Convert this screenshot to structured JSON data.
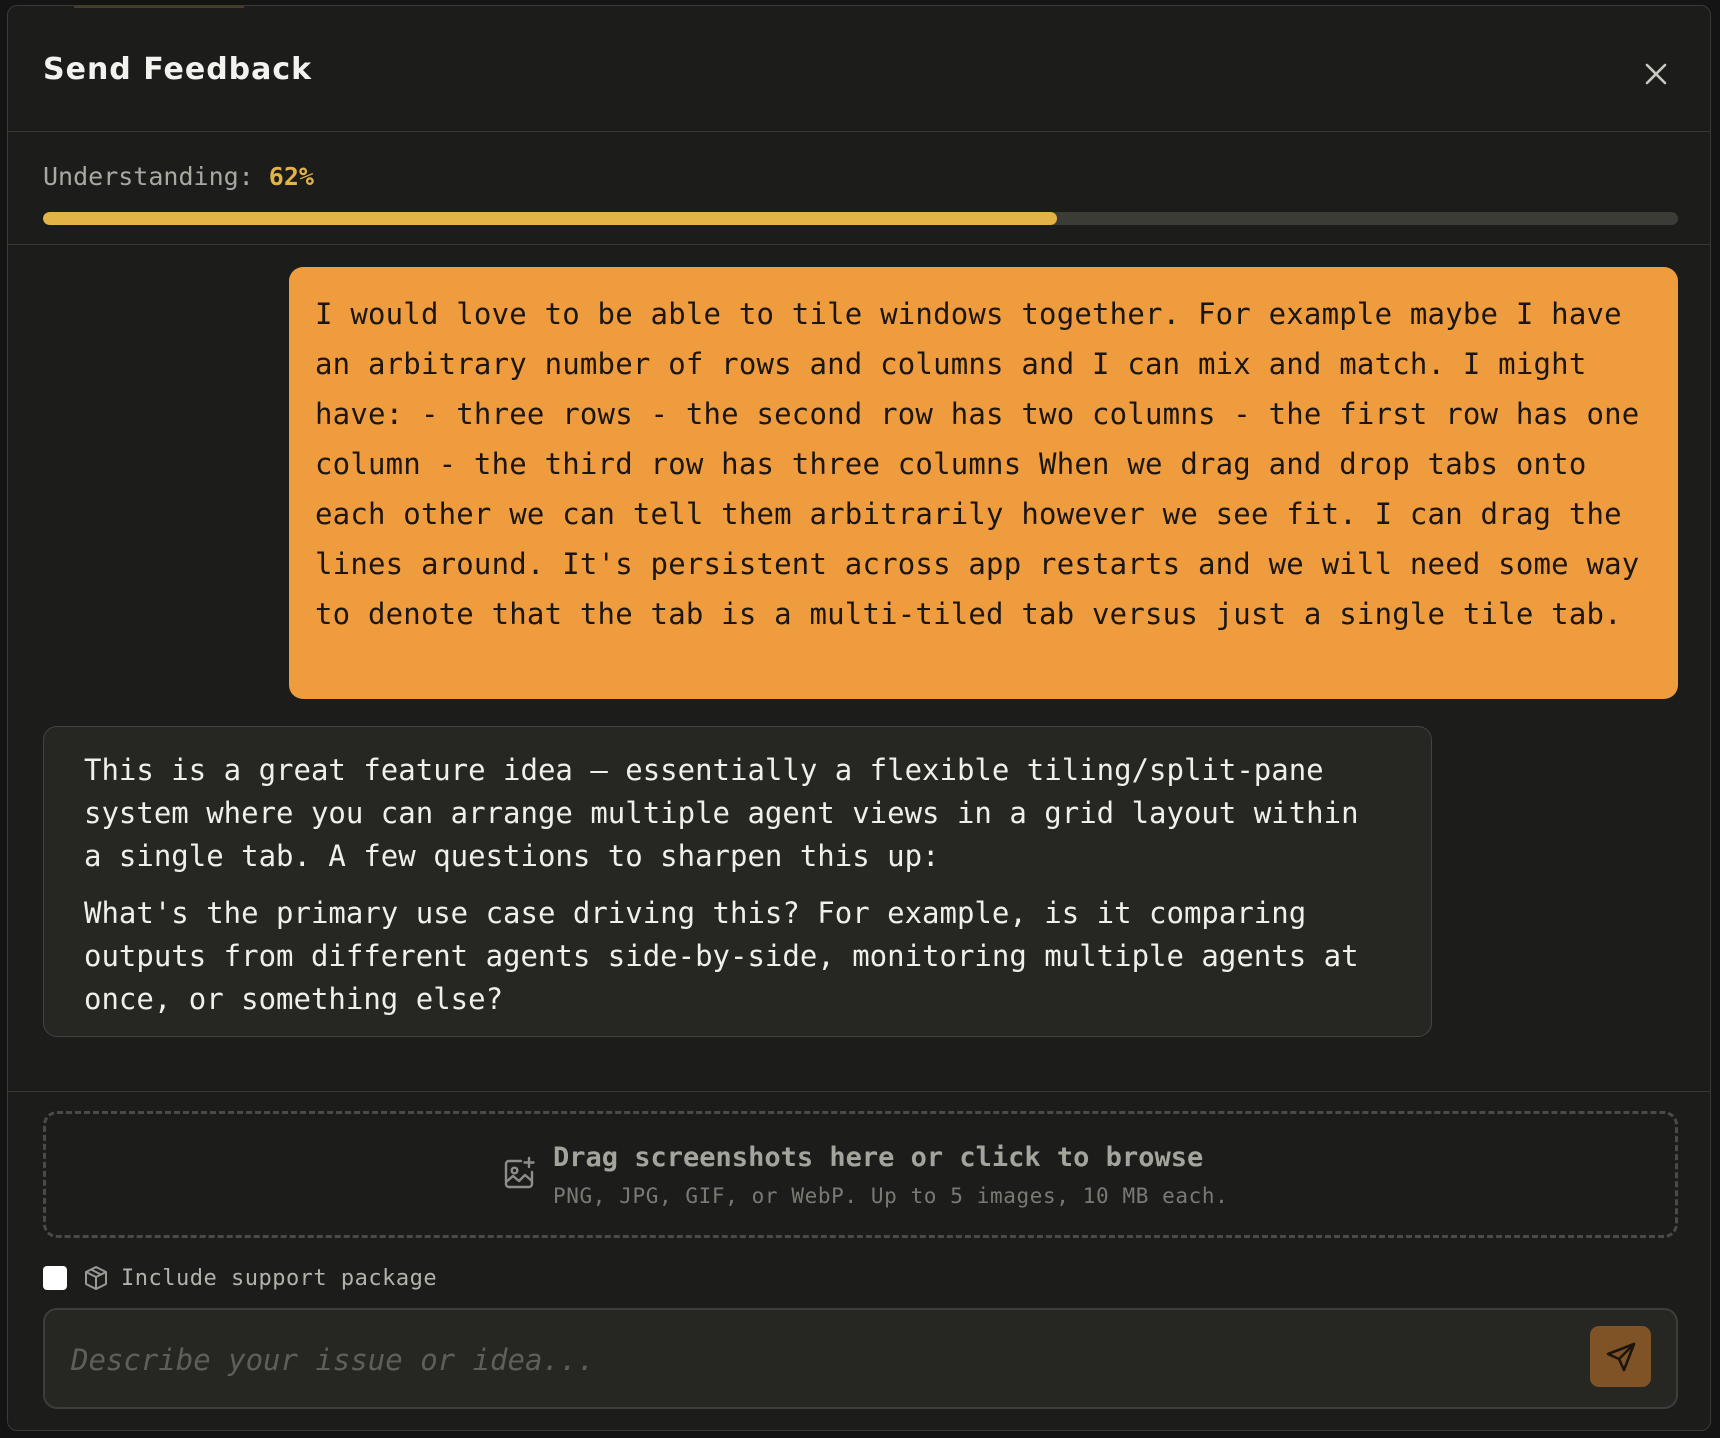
{
  "dialog": {
    "title": "Send Feedback"
  },
  "understanding": {
    "label": "Understanding:",
    "value_text": "62%",
    "fraction": 0.62
  },
  "messages": {
    "user": "I would love to be able to tile windows together. For example maybe I have an arbitrary number of rows and columns and I can mix and match. I might have: - three rows - the second row has two columns - the first row has one column - the third row has three columns When we drag and drop tabs onto each other we can tell them arbitrarily however we see fit. I can drag the lines around. It's persistent across app restarts and we will need some way to denote that the tab is a multi-tiled tab versus just a single tile tab.",
    "assistant_p1": "This is a great feature idea — essentially a flexible tiling/split-pane system where you can arrange multiple agent views in a grid layout within a single tab. A few questions to sharpen this up:",
    "assistant_p2": "What's the primary use case driving this? For example, is it comparing outputs from different agents side-by-side, monitoring multiple agents at once, or something else?"
  },
  "dropzone": {
    "title": "Drag screenshots here or click to browse",
    "subtitle": "PNG, JPG, GIF, or WebP. Up to 5 images, 10 MB each.",
    "icon": "image-plus-icon"
  },
  "support": {
    "label": "Include support package",
    "checked": false,
    "icon": "package-icon"
  },
  "input": {
    "placeholder": "Describe your issue or idea...",
    "value": ""
  },
  "icons": {
    "close": "close-icon",
    "send": "send-icon"
  },
  "colors": {
    "accent": "#e2b347",
    "user_bubble": "#ef9c3e",
    "send_button": "#7f5326"
  }
}
